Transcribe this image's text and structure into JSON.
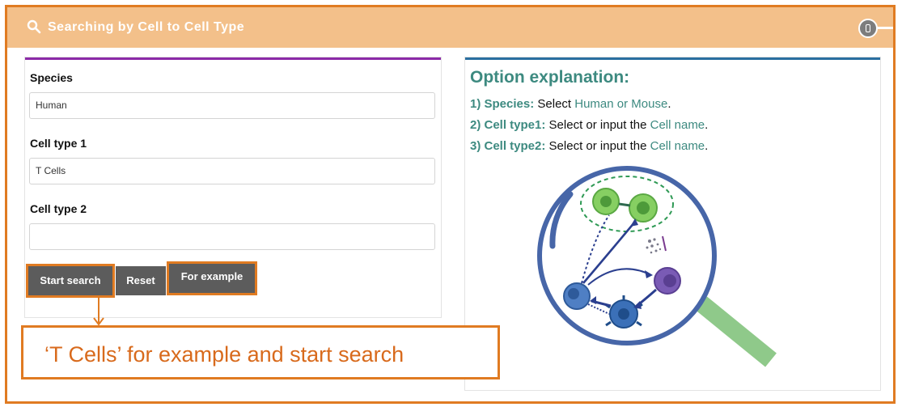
{
  "header": {
    "title": "Searching by Cell to Cell Type",
    "search_icon": "search-icon",
    "toggle_icon": "toggle-icon"
  },
  "form": {
    "species_label": "Species",
    "species_value": "Human",
    "cell_type1_label": "Cell type 1",
    "cell_type1_value": "T Cells",
    "cell_type2_label": "Cell type 2",
    "cell_type2_value": "",
    "start_search_label": "Start search",
    "reset_label": "Reset",
    "example_label": "For example"
  },
  "explanation": {
    "title": "Option explanation:",
    "line1_key": "1) Species:",
    "line1_text": " Select ",
    "line1_highlight": "Human or Mouse",
    "line1_end": ".",
    "line2_key": "2) Cell type1:",
    "line2_text": " Select or input the ",
    "line2_highlight": "Cell name",
    "line2_end": ".",
    "line3_key": "3) Cell type2:",
    "line3_text": " Select or input the ",
    "line3_highlight": "Cell name",
    "line3_end": ".",
    "illustration": "magnifier-cells-illustration"
  },
  "annotation": {
    "text": "‘T Cells’ for example and start search"
  },
  "colors": {
    "accent_orange": "#e07b22",
    "header_bg": "#f3c08a",
    "button_gray": "#5c5c5c",
    "teal_text": "#3d8a80",
    "purple_border": "#8c2aa8",
    "blue_border": "#2a6fa0"
  }
}
